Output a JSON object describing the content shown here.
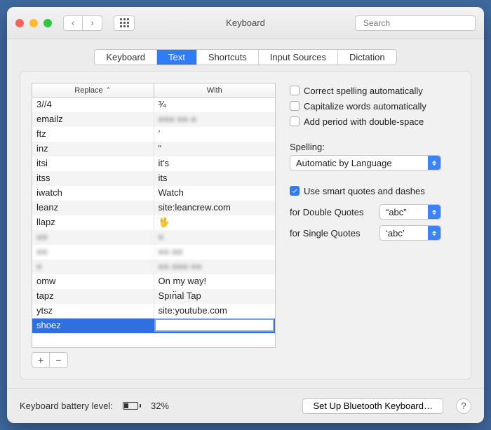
{
  "window": {
    "title": "Keyboard",
    "search_placeholder": "Search"
  },
  "tabs": [
    "Keyboard",
    "Text",
    "Shortcuts",
    "Input Sources",
    "Dictation"
  ],
  "active_tab_index": 1,
  "table": {
    "columns": [
      "Replace",
      "With"
    ],
    "rows": [
      {
        "replace": "3//4",
        "with": "¾"
      },
      {
        "replace": "emailz",
        "with": "●●● ●● ●",
        "blur_with": true
      },
      {
        "replace": "ftz",
        "with": "ʼ"
      },
      {
        "replace": "inz",
        "with": "ʺ"
      },
      {
        "replace": "itsi",
        "with": "it's"
      },
      {
        "replace": "itss",
        "with": "its"
      },
      {
        "replace": "iwatch",
        "with": "Watch"
      },
      {
        "replace": "leanz",
        "with": "site:leancrew.com"
      },
      {
        "replace": "llapz",
        "with": "🖖"
      },
      {
        "replace": "●●",
        "with": "●",
        "blur_replace": true,
        "blur_with": true
      },
      {
        "replace": "●●",
        "with": "●● ●●",
        "blur_replace": true,
        "blur_with": true
      },
      {
        "replace": "●",
        "with": "●● ●●● ●●",
        "blur_replace": true,
        "blur_with": true
      },
      {
        "replace": "omw",
        "with": "On my way!"
      },
      {
        "replace": "tapz",
        "with": "Spın̈al Tap"
      },
      {
        "replace": "ytsz",
        "with": "site:youtube.com"
      },
      {
        "replace": "shoez",
        "with": "",
        "selected": true,
        "editing_with": true
      }
    ]
  },
  "checkboxes": {
    "correct_spelling": {
      "label": "Correct spelling automatically",
      "checked": false
    },
    "capitalize": {
      "label": "Capitalize words automatically",
      "checked": false
    },
    "double_space_period": {
      "label": "Add period with double-space",
      "checked": false
    },
    "smart_quotes": {
      "label": "Use smart quotes and dashes",
      "checked": true
    }
  },
  "spelling": {
    "label": "Spelling:",
    "value": "Automatic by Language"
  },
  "double_quotes": {
    "label": "for Double Quotes",
    "value": "“abc”"
  },
  "single_quotes": {
    "label": "for Single Quotes",
    "value": "‘abc’"
  },
  "footer": {
    "battery_label": "Keyboard battery level:",
    "battery_pct": "32%",
    "bluetooth_btn": "Set Up Bluetooth Keyboard…"
  }
}
